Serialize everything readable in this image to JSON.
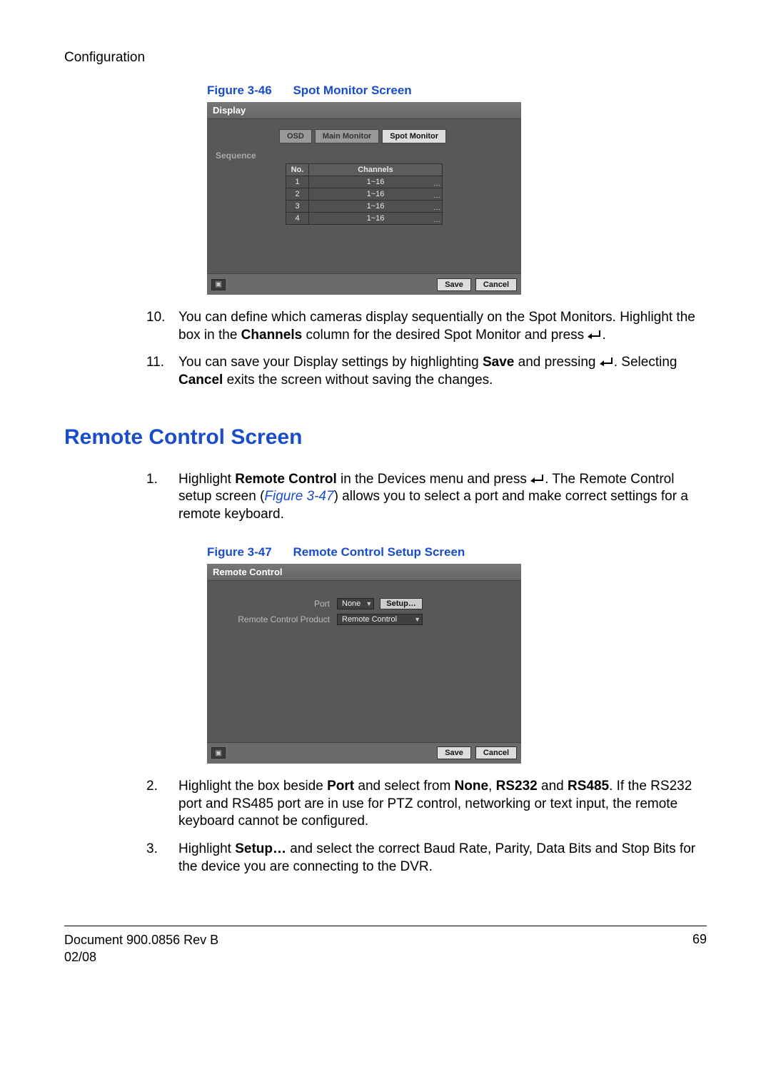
{
  "header": {
    "title": "Configuration"
  },
  "figure46": {
    "label": "Figure 3-46",
    "title": "Spot Monitor Screen",
    "screenshot": {
      "titlebar": "Display",
      "tabs": {
        "osd": "OSD",
        "main": "Main Monitor",
        "spot": "Spot Monitor"
      },
      "sequence_label": "Sequence",
      "table": {
        "head_no": "No.",
        "head_channels": "Channels",
        "rows": [
          {
            "no": "1",
            "channels": "1~16"
          },
          {
            "no": "2",
            "channels": "1~16"
          },
          {
            "no": "3",
            "channels": "1~16"
          },
          {
            "no": "4",
            "channels": "1~16"
          }
        ]
      },
      "save": "Save",
      "cancel": "Cancel"
    }
  },
  "step10": {
    "num": "10.",
    "t1": "You can define which cameras display sequentially on the Spot Monitors. Highlight the box in the ",
    "bold1": "Channels",
    "t2": " column for the desired Spot Monitor and press ",
    "t3": "."
  },
  "step11": {
    "num": "11.",
    "t1": "You can save your Display settings by highlighting ",
    "bold1": "Save",
    "t2": " and pressing ",
    "t3": ". Selecting ",
    "bold2": "Cancel",
    "t4": " exits the screen without saving the changes."
  },
  "sectionTitle": "Remote Control Screen",
  "rc_step1": {
    "num": "1.",
    "t1": "Highlight ",
    "bold1": "Remote Control",
    "t2": " in the Devices menu and press ",
    "t3": ". The Remote Control setup screen (",
    "figref": "Figure 3-47",
    "t4": ") allows you to select a port and make correct settings for a remote keyboard."
  },
  "figure47": {
    "label": "Figure 3-47",
    "title": "Remote Control Setup Screen",
    "screenshot": {
      "titlebar": "Remote Control",
      "port_label": "Port",
      "port_value": "None",
      "setup_btn": "Setup…",
      "product_label": "Remote Control Product",
      "product_value": "Remote Control",
      "save": "Save",
      "cancel": "Cancel"
    }
  },
  "rc_step2": {
    "num": "2.",
    "t1": "Highlight the box beside ",
    "bold1": "Port",
    "t2": " and select from ",
    "bold2": "None",
    "t3": ", ",
    "bold3": "RS232",
    "t4": " and ",
    "bold4": "RS485",
    "t5": ". If the RS232 port and RS485 port are in use for PTZ control, networking or text input, the remote keyboard cannot be configured."
  },
  "rc_step3": {
    "num": "3.",
    "t1": "Highlight ",
    "bold1": "Setup…",
    "t2": " and select the correct Baud Rate, Parity, Data Bits and Stop Bits for the device you are connecting to the DVR."
  },
  "footer": {
    "doc": "Document 900.0856 Rev B",
    "date": "02/08",
    "page": "69"
  }
}
